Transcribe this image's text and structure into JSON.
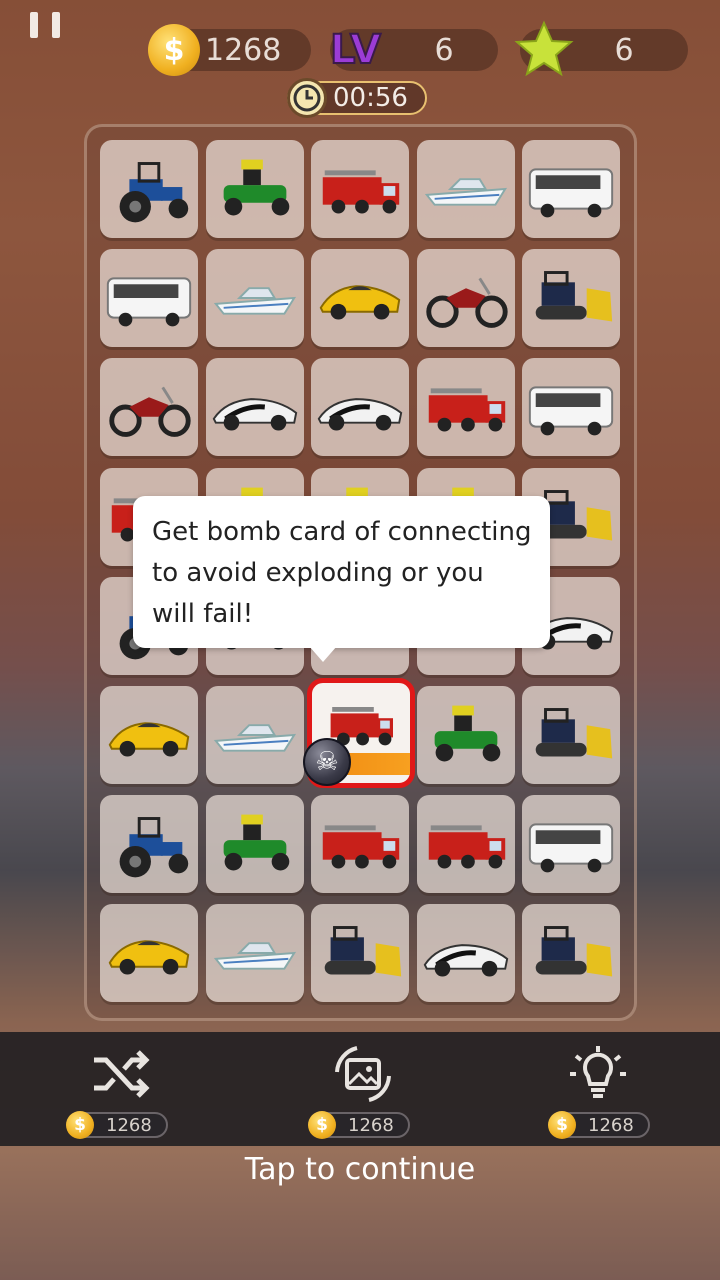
{
  "hud": {
    "coins": "1268",
    "level_label": "LV",
    "level": "6",
    "stars": "6",
    "timer": "00:56"
  },
  "board": {
    "rows": [
      [
        "tractor",
        "lawn-mower",
        "fire-truck",
        "speedboat",
        "bus"
      ],
      [
        "bus",
        "speedboat",
        "sports-car",
        "motorcycle",
        "bulldozer"
      ],
      [
        "motorcycle",
        "supercar",
        "supercar",
        "fire-truck",
        "bus"
      ],
      [
        "fire-truck",
        "lawn-mower",
        "lawn-mower",
        "lawn-mower",
        "bulldozer"
      ],
      [
        "tractor",
        "supercar",
        "speedboat",
        "speedboat",
        "supercar"
      ],
      [
        "sports-car",
        "speedboat",
        "fire-truck",
        "lawn-mower",
        "bulldozer"
      ],
      [
        "tractor",
        "lawn-mower",
        "fire-truck",
        "fire-truck",
        "bus"
      ],
      [
        "sports-car",
        "speedboat",
        "bulldozer",
        "supercar",
        "bulldozer"
      ]
    ],
    "bomb_tile": "fire-truck"
  },
  "tooltip": {
    "line1": "Get bomb card of connecting",
    "line2": "to avoid exploding or you",
    "line3": "will fail!"
  },
  "tools": [
    {
      "name": "shuffle",
      "icon": "shuffle-icon",
      "cost": "1268"
    },
    {
      "name": "refresh-image",
      "icon": "refresh-image-icon",
      "cost": "1268"
    },
    {
      "name": "hint",
      "icon": "lightbulb-icon",
      "cost": "1268"
    }
  ],
  "tap_to_continue": "Tap to continue",
  "colors": {
    "highlight": "#e01818",
    "tooltip_bg": "#ffffff",
    "coin": "#f0b020"
  }
}
